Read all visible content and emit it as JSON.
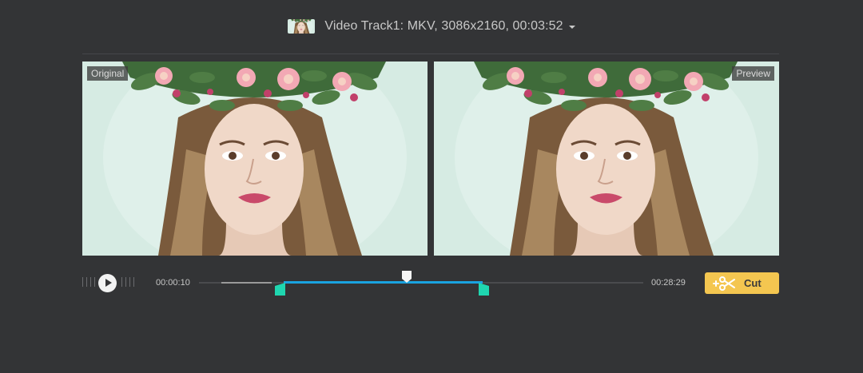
{
  "header": {
    "track_title": "Video Track1: MKV, 3086x2160, 00:03:52",
    "thumbnail_icon": "portrait-thumbnail",
    "dropdown_icon": "caret-down-icon"
  },
  "panes": {
    "original_label": "Original",
    "preview_label": "Preview"
  },
  "timeline": {
    "start_time": "00:00:10",
    "end_time": "00:28:29",
    "play_icon": "play-icon",
    "accent_color": "#1aa3e0",
    "handle_color": "#1fd6b0"
  },
  "actions": {
    "cut_label": "Cut",
    "cut_icon": "add-scissors-icon",
    "cut_color": "#f4c650"
  }
}
